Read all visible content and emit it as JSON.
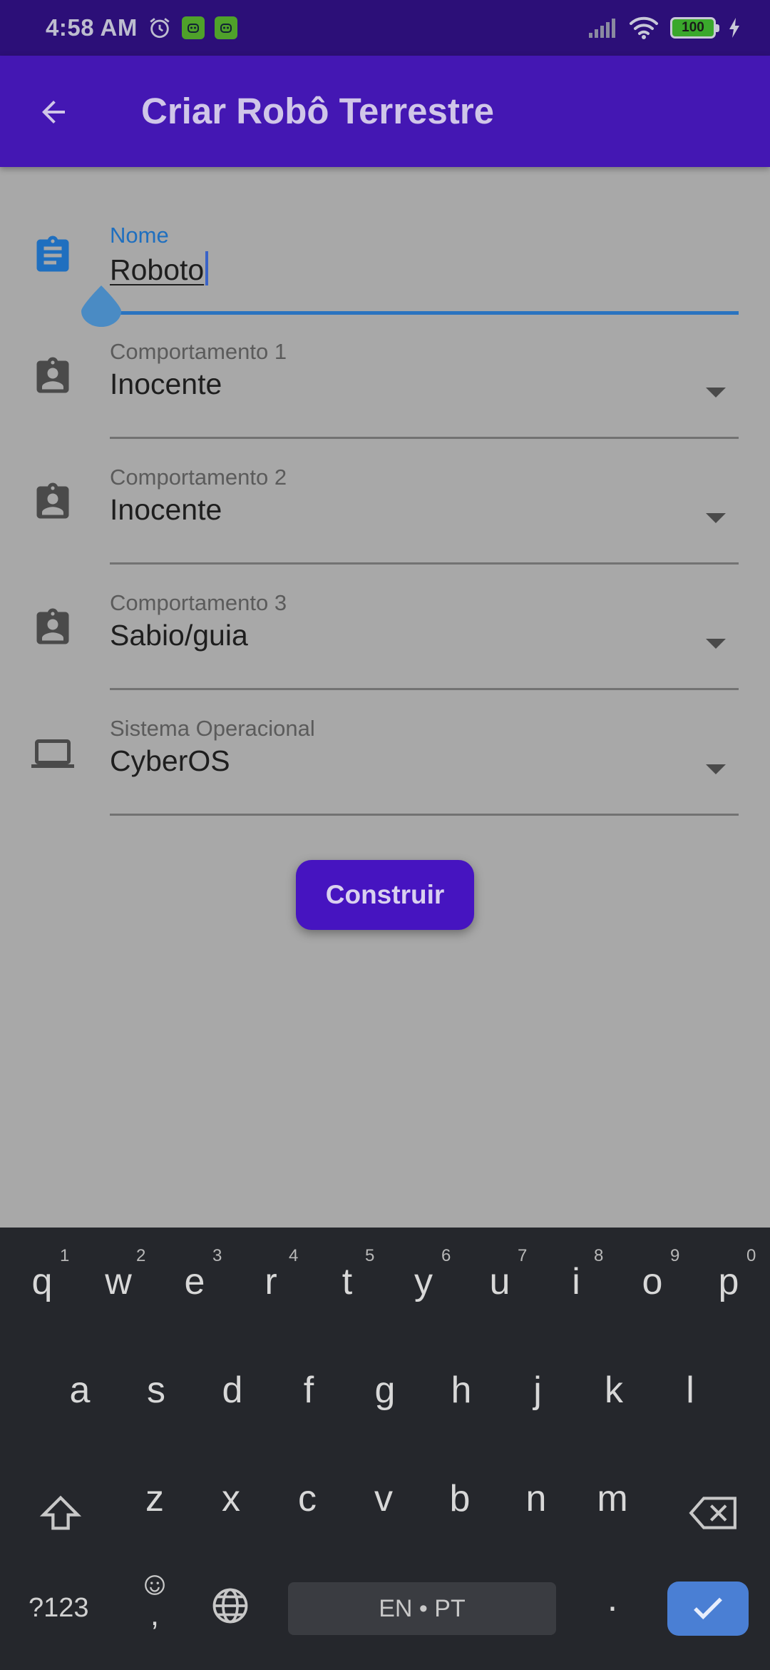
{
  "status_bar": {
    "time": "4:58 AM",
    "battery": "100",
    "icons": [
      "alarm-icon",
      "app-badge-icon",
      "app-badge-icon",
      "signal-icon",
      "wifi-icon",
      "battery-icon",
      "charging-icon"
    ]
  },
  "app_bar": {
    "title": "Criar Robô Terrestre",
    "back_icon": "arrow-left-icon"
  },
  "form": {
    "name": {
      "label": "Nome",
      "value": "Roboto",
      "icon": "assignment-icon"
    },
    "behavior1": {
      "label": "Comportamento 1",
      "value": "Inocente",
      "icon": "assignment-ind-icon"
    },
    "behavior2": {
      "label": "Comportamento 2",
      "value": "Inocente",
      "icon": "assignment-ind-icon"
    },
    "behavior3": {
      "label": "Comportamento 3",
      "value": "Sabio/guia",
      "icon": "assignment-ind-icon"
    },
    "os": {
      "label": "Sistema Operacional",
      "value": "CyberOS",
      "icon": "laptop-icon"
    }
  },
  "build_button": {
    "label": "Construir"
  },
  "keyboard": {
    "row1": [
      "q",
      "w",
      "e",
      "r",
      "t",
      "y",
      "u",
      "i",
      "o",
      "p"
    ],
    "row1_hints": [
      "1",
      "2",
      "3",
      "4",
      "5",
      "6",
      "7",
      "8",
      "9",
      "0"
    ],
    "row2": [
      "a",
      "s",
      "d",
      "f",
      "g",
      "h",
      "j",
      "k",
      "l"
    ],
    "row3": [
      "z",
      "x",
      "c",
      "v",
      "b",
      "n",
      "m"
    ],
    "symbols_label": "?123",
    "emoji_comma": ",",
    "space_label": "EN • PT",
    "period": "."
  },
  "colors": {
    "status_bar": "#2c0f78",
    "app_bar": "#4417b3",
    "accent": "#2a73bf",
    "button": "#4614c0",
    "keyboard": "#25272c",
    "enter_key": "#4a7fd4"
  }
}
